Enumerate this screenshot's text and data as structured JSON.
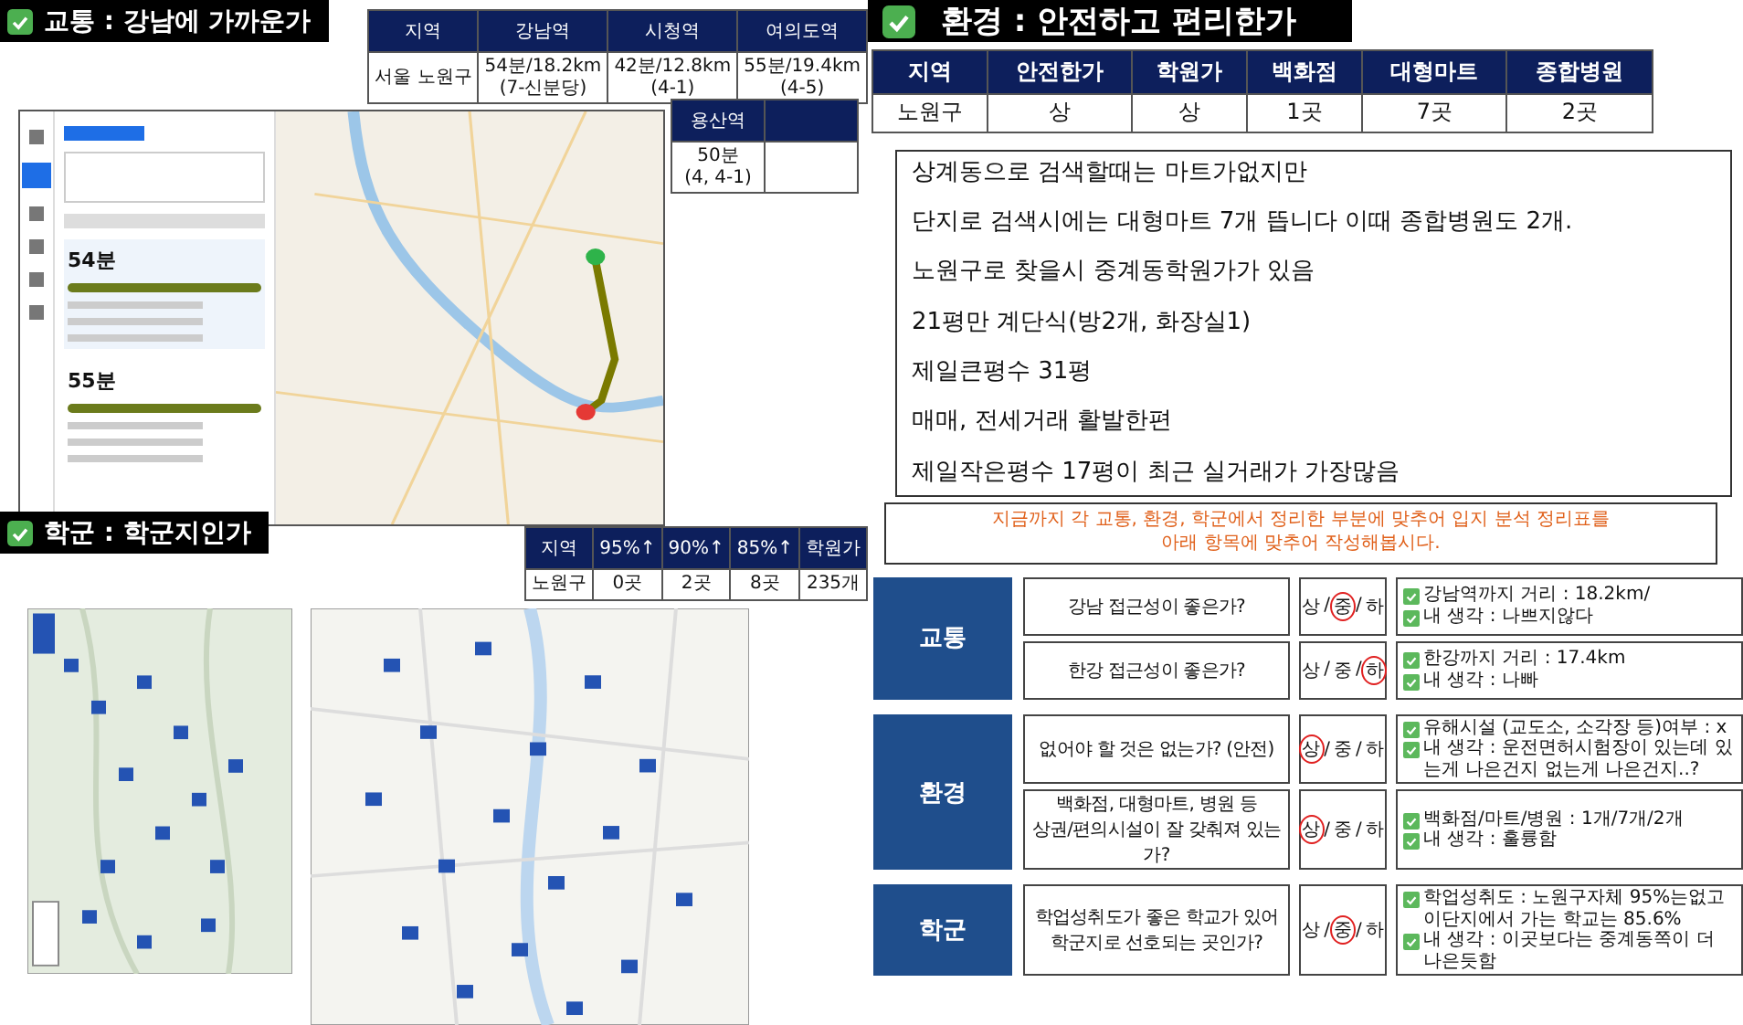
{
  "transport": {
    "title": "교통 : 강남에 가까운가",
    "table": {
      "columns": [
        "지역",
        "강남역",
        "시청역",
        "여의도역"
      ],
      "rows": [
        [
          "서울 노원구",
          "54분/18.2km\n(7-신분당)",
          "42분/12.8km\n(4-1)",
          "55분/19.4km\n(4-5)"
        ]
      ]
    },
    "extra_table": {
      "columns": [
        "용산역"
      ],
      "rows": [
        [
          "50분\n(4, 4-1)"
        ]
      ]
    },
    "route_times": [
      "54분",
      "55분"
    ]
  },
  "environment": {
    "title": "환경 : 안전하고 편리한가",
    "table": {
      "columns": [
        "지역",
        "안전한가",
        "학원가",
        "백화점",
        "대형마트",
        "종합병원"
      ],
      "rows": [
        [
          "노원구",
          "상",
          "상",
          "1곳",
          "7곳",
          "2곳"
        ]
      ]
    },
    "notes": [
      "상계동으로 검색할때는 마트가없지만",
      "단지로 검색시에는 대형마트 7개 뜹니다 이때 종합병원도 2개.",
      "노원구로 찾을시 중계동학원가가 있음",
      "21평만 계단식(방2개, 화장실1)",
      "제일큰평수 31평",
      "매매, 전세거래 활발한편",
      "제일작은평수 17평이 최근 실거래가 가장많음"
    ]
  },
  "notice": "지금까지 각 교통, 환경, 학군에서 정리한 부분에 맞추어 입지 분석 정리표를\n아래 항목에 맞추어 작성해봅시다.",
  "school": {
    "title": "학군 : 학군지인가",
    "table": {
      "columns": [
        "지역",
        "95%↑",
        "90%↑",
        "85%↑",
        "학원가"
      ],
      "rows": [
        [
          "노원구",
          "0곳",
          "2곳",
          "8곳",
          "235개"
        ]
      ]
    }
  },
  "analysis": {
    "separator": "/",
    "groups": [
      {
        "category": "교통",
        "items": [
          {
            "question": "강남 접근성이 좋은가?",
            "options": [
              {
                "label": "상",
                "selected": false
              },
              {
                "label": "중",
                "selected": true
              },
              {
                "label": "하",
                "selected": false
              }
            ],
            "notes": [
              "강남역까지 거리 : 18.2km/",
              "내 생각 : 나쁘지않다"
            ]
          },
          {
            "question": "한강 접근성이 좋은가?",
            "options": [
              {
                "label": "상",
                "selected": false
              },
              {
                "label": "중",
                "selected": false
              },
              {
                "label": "하",
                "selected": true
              }
            ],
            "notes": [
              "한강까지 거리 : 17.4km",
              "내 생각 : 나빠"
            ]
          }
        ]
      },
      {
        "category": "환경",
        "items": [
          {
            "question": "없어야 할 것은 없는가? (안전)",
            "options": [
              {
                "label": "상",
                "selected": true
              },
              {
                "label": "중",
                "selected": false
              },
              {
                "label": "하",
                "selected": false
              }
            ],
            "notes": [
              "유해시설 (교도소, 소각장 등)여부 : x",
              "내 생각 : 운전면허시험장이 있는데 있는게 나은건지 없는게 나은건지..?"
            ]
          },
          {
            "question": "백화점, 대형마트, 병원 등\n상권/편의시설이 잘 갖춰져 있는가?",
            "options": [
              {
                "label": "상",
                "selected": true
              },
              {
                "label": "중",
                "selected": false
              },
              {
                "label": "하",
                "selected": false
              }
            ],
            "notes": [
              "백화점/마트/병원 : 1개/7개/2개",
              "내 생각 :  훌륭함"
            ]
          }
        ]
      },
      {
        "category": "학군",
        "items": [
          {
            "question": "학업성취도가 좋은 학교가 있어\n학군지로 선호되는 곳인가?",
            "options": [
              {
                "label": "상",
                "selected": false
              },
              {
                "label": "중",
                "selected": true
              },
              {
                "label": "하",
                "selected": false
              }
            ],
            "notes": [
              "학업성취도 : 노원구자체 95%는없고 이단지에서 가는 학교는 85.6%",
              "내 생각 : 이곳보다는 중계동쪽이 더 나은듯함"
            ]
          }
        ]
      }
    ]
  }
}
